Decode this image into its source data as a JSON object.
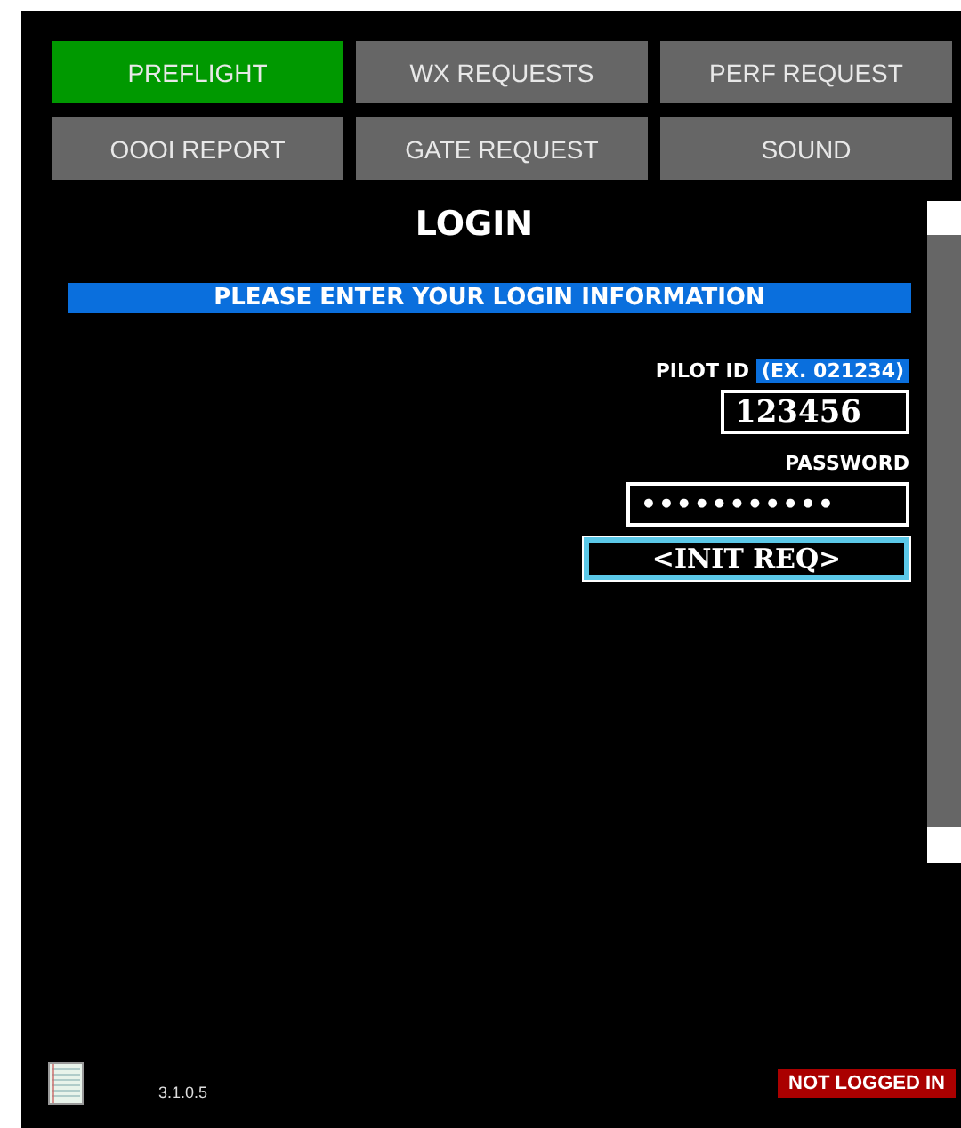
{
  "tabs": [
    {
      "label": "PREFLIGHT",
      "selected": true
    },
    {
      "label": "WX REQUESTS",
      "selected": false
    },
    {
      "label": "PERF REQUEST",
      "selected": false
    },
    {
      "label": "OOOI REPORT",
      "selected": false
    },
    {
      "label": "GATE REQUEST",
      "selected": false
    },
    {
      "label": "SOUND",
      "selected": false
    }
  ],
  "title": "LOGIN",
  "banner": "PLEASE ENTER YOUR LOGIN INFORMATION",
  "pilot_id": {
    "label": "PILOT ID",
    "hint": "(EX. 021234)",
    "value": "123456"
  },
  "password": {
    "label": "PASSWORD",
    "value": "•••••••••••"
  },
  "submit": "<INIT REQ>",
  "footer": {
    "version": "3.1.0.5",
    "status": "NOT LOGGED IN"
  }
}
